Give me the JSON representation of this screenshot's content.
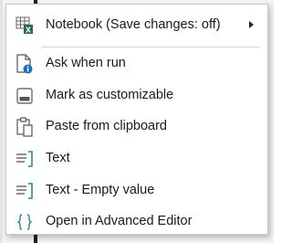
{
  "menu": {
    "items": [
      {
        "label": "Notebook (Save changes: off)",
        "icon": "table-excel-icon",
        "has_submenu": true
      },
      {
        "label": "Ask when run",
        "icon": "document-info-icon"
      },
      {
        "label": "Mark as customizable",
        "icon": "window-panel-icon"
      },
      {
        "label": "Paste from clipboard",
        "icon": "clipboard-icon"
      },
      {
        "label": "Text",
        "icon": "text-lines-icon"
      },
      {
        "label": "Text - Empty value",
        "icon": "text-lines-icon"
      },
      {
        "label": "Open in Advanced Editor",
        "icon": "braces-icon"
      }
    ]
  },
  "colors": {
    "icon_dark": "#5a5a5a",
    "icon_teal": "#2b8a8a",
    "icon_blue": "#1a6fc2",
    "excel_green": "#1e7145"
  }
}
